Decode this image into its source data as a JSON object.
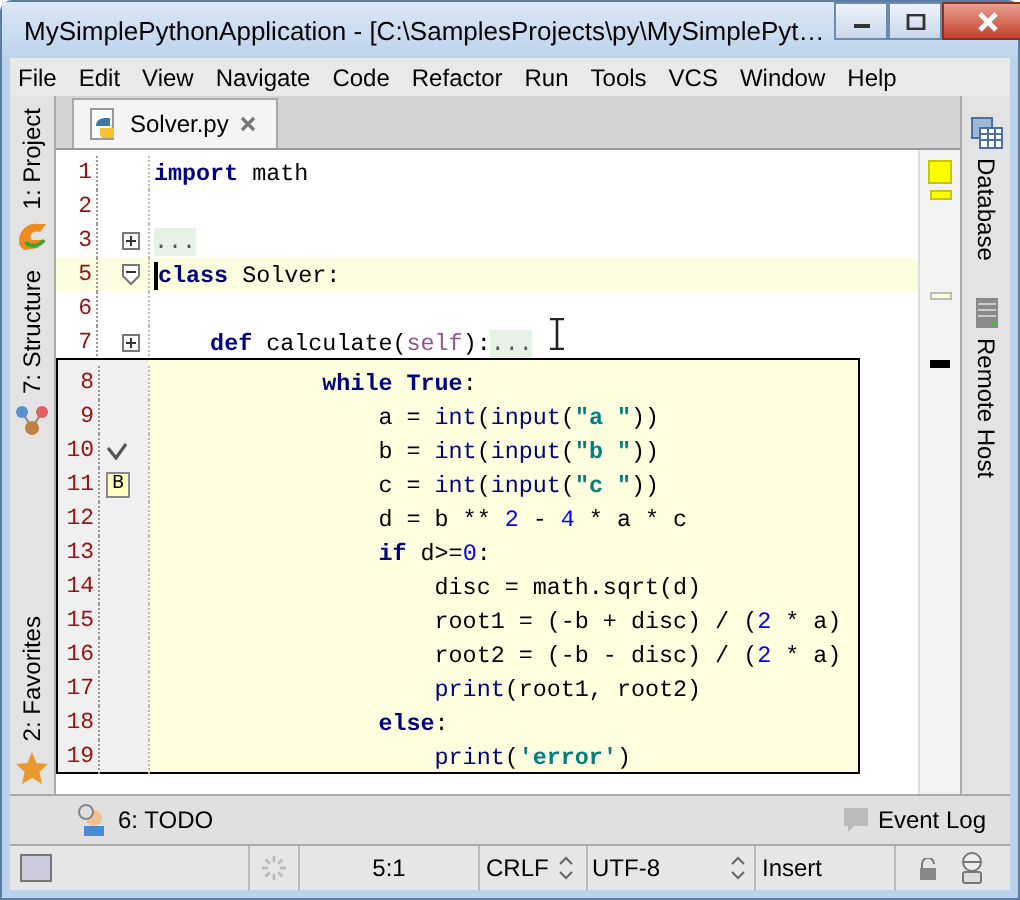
{
  "window": {
    "title": "MySimplePythonApplication - [C:\\SamplesProjects\\py\\MySimplePyt…"
  },
  "menu": [
    "File",
    "Edit",
    "View",
    "Navigate",
    "Code",
    "Refactor",
    "Run",
    "Tools",
    "VCS",
    "Window",
    "Help"
  ],
  "left_tool_windows": [
    {
      "label": "1: Project",
      "kind": "project"
    },
    {
      "label": "7: Structure",
      "kind": "structure"
    },
    {
      "label": "2: Favorites",
      "kind": "favorites"
    }
  ],
  "right_tool_windows": [
    {
      "label": "Database",
      "kind": "database"
    },
    {
      "label": "Remote Host",
      "kind": "remote"
    }
  ],
  "tabs": [
    {
      "label": "Solver.py",
      "selected": true
    }
  ],
  "editor": {
    "lines": [
      {
        "number": "1",
        "kind": "plain",
        "current": false,
        "segments": [
          {
            "text": "import",
            "kind": "kw"
          },
          {
            "text": " math",
            "kind": "plain"
          }
        ]
      },
      {
        "number": "2",
        "kind": "plain",
        "current": false
      },
      {
        "number": "3",
        "kind": "folded",
        "current": false,
        "segments": [
          {
            "text": "...",
            "kind": "fold"
          }
        ]
      },
      {
        "number": "5",
        "kind": "fold_start",
        "current": true,
        "segments": [
          {
            "text": "class",
            "kind": "kw"
          },
          {
            "text": " Solver:",
            "kind": "plain"
          }
        ]
      },
      {
        "number": "6",
        "kind": "plain",
        "current": false
      },
      {
        "number": "7",
        "kind": "folded",
        "current": false,
        "segments": [
          {
            "text": "    def",
            "kind": "kw"
          },
          {
            "text": " calculate(",
            "kind": "plain"
          },
          {
            "text": "self",
            "kind": "self"
          },
          {
            "text": "):",
            "kind": "plain"
          },
          {
            "text": "...",
            "kind": "fold"
          }
        ]
      }
    ]
  },
  "popup": {
    "lines": [
      {
        "number": "8",
        "kind": "plain",
        "segments": [
          {
            "text": "            while True",
            "kind": "kw"
          },
          {
            "text": ":",
            "kind": "plain"
          }
        ]
      },
      {
        "number": "9",
        "kind": "plain",
        "segments": [
          {
            "text": "                a = ",
            "kind": "plain"
          },
          {
            "text": "int",
            "kind": "builtin"
          },
          {
            "text": "(",
            "kind": "plain"
          },
          {
            "text": "input",
            "kind": "builtin"
          },
          {
            "text": "(",
            "kind": "plain"
          },
          {
            "text": "\"a \"",
            "kind": "str"
          },
          {
            "text": "))",
            "kind": "plain"
          }
        ]
      },
      {
        "number": "10",
        "kind": "check",
        "segments": [
          {
            "text": "                b = ",
            "kind": "plain"
          },
          {
            "text": "int",
            "kind": "builtin"
          },
          {
            "text": "(",
            "kind": "plain"
          },
          {
            "text": "input",
            "kind": "builtin"
          },
          {
            "text": "(",
            "kind": "plain"
          },
          {
            "text": "\"b \"",
            "kind": "str"
          },
          {
            "text": "))",
            "kind": "plain"
          }
        ]
      },
      {
        "number": "11",
        "kind": "bookmark",
        "bookmark": "B",
        "segments": [
          {
            "text": "                c = ",
            "kind": "plain"
          },
          {
            "text": "int",
            "kind": "builtin"
          },
          {
            "text": "(",
            "kind": "plain"
          },
          {
            "text": "input",
            "kind": "builtin"
          },
          {
            "text": "(",
            "kind": "plain"
          },
          {
            "text": "\"c \"",
            "kind": "str"
          },
          {
            "text": "))",
            "kind": "plain"
          }
        ]
      },
      {
        "number": "12",
        "kind": "plain",
        "segments": [
          {
            "text": "                d = b ** ",
            "kind": "plain"
          },
          {
            "text": "2",
            "kind": "num"
          },
          {
            "text": " - ",
            "kind": "plain"
          },
          {
            "text": "4",
            "kind": "num"
          },
          {
            "text": " * a * c",
            "kind": "plain"
          }
        ]
      },
      {
        "number": "13",
        "kind": "plain",
        "segments": [
          {
            "text": "                if",
            "kind": "kw"
          },
          {
            "text": " d>=",
            "kind": "plain"
          },
          {
            "text": "0",
            "kind": "num"
          },
          {
            "text": ":",
            "kind": "plain"
          }
        ]
      },
      {
        "number": "14",
        "kind": "plain",
        "segments": [
          {
            "text": "                    disc = math.sqrt(d)",
            "kind": "plain"
          }
        ]
      },
      {
        "number": "15",
        "kind": "plain",
        "segments": [
          {
            "text": "                    root1 = (-b + disc) / (",
            "kind": "plain"
          },
          {
            "text": "2",
            "kind": "num"
          },
          {
            "text": " * a)",
            "kind": "plain"
          }
        ]
      },
      {
        "number": "16",
        "kind": "plain",
        "segments": [
          {
            "text": "                    root2 = (-b - disc) / (",
            "kind": "plain"
          },
          {
            "text": "2",
            "kind": "num"
          },
          {
            "text": " * a)",
            "kind": "plain"
          }
        ]
      },
      {
        "number": "17",
        "kind": "plain",
        "segments": [
          {
            "text": "                    print",
            "kind": "builtin"
          },
          {
            "text": "(root1, root2)",
            "kind": "plain"
          }
        ]
      },
      {
        "number": "18",
        "kind": "plain",
        "segments": [
          {
            "text": "                else",
            "kind": "kw"
          },
          {
            "text": ":",
            "kind": "plain"
          }
        ]
      },
      {
        "number": "19",
        "kind": "plain",
        "segments": [
          {
            "text": "                    print",
            "kind": "builtin"
          },
          {
            "text": "(",
            "kind": "plain"
          },
          {
            "text": "'error'",
            "kind": "str"
          },
          {
            "text": ")",
            "kind": "plain"
          }
        ]
      }
    ]
  },
  "tool_bar": {
    "left": "6: TODO",
    "right": "Event Log"
  },
  "status_bar": {
    "position": "5:1",
    "line_separator": "CRLF",
    "encoding": "UTF-8",
    "mode": "Insert"
  }
}
